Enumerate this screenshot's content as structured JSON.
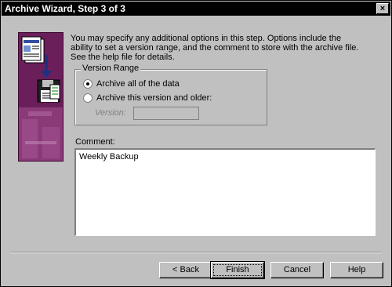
{
  "window": {
    "title": "Archive Wizard, Step 3 of 3",
    "close_label": "×"
  },
  "intro": {
    "text": "You may specify any additional options in this step.  Options include the ability to set a version range, and the comment to store with the archive file.  See the help file for details."
  },
  "version_range": {
    "label": "Version Range",
    "options": [
      {
        "label": "Archive all of the data",
        "checked": true
      },
      {
        "label": "Archive this version and older:",
        "checked": false
      }
    ],
    "version_label": "Version:",
    "version_value": ""
  },
  "comment": {
    "label": "Comment:",
    "value": "Weekly Backup"
  },
  "buttons": {
    "back": "< Back",
    "finish": "Finish",
    "cancel": "Cancel",
    "help": "Help"
  },
  "colors": {
    "illustration_bg": "#6b1f5a",
    "dialog_bg": "#c0c0c0"
  }
}
